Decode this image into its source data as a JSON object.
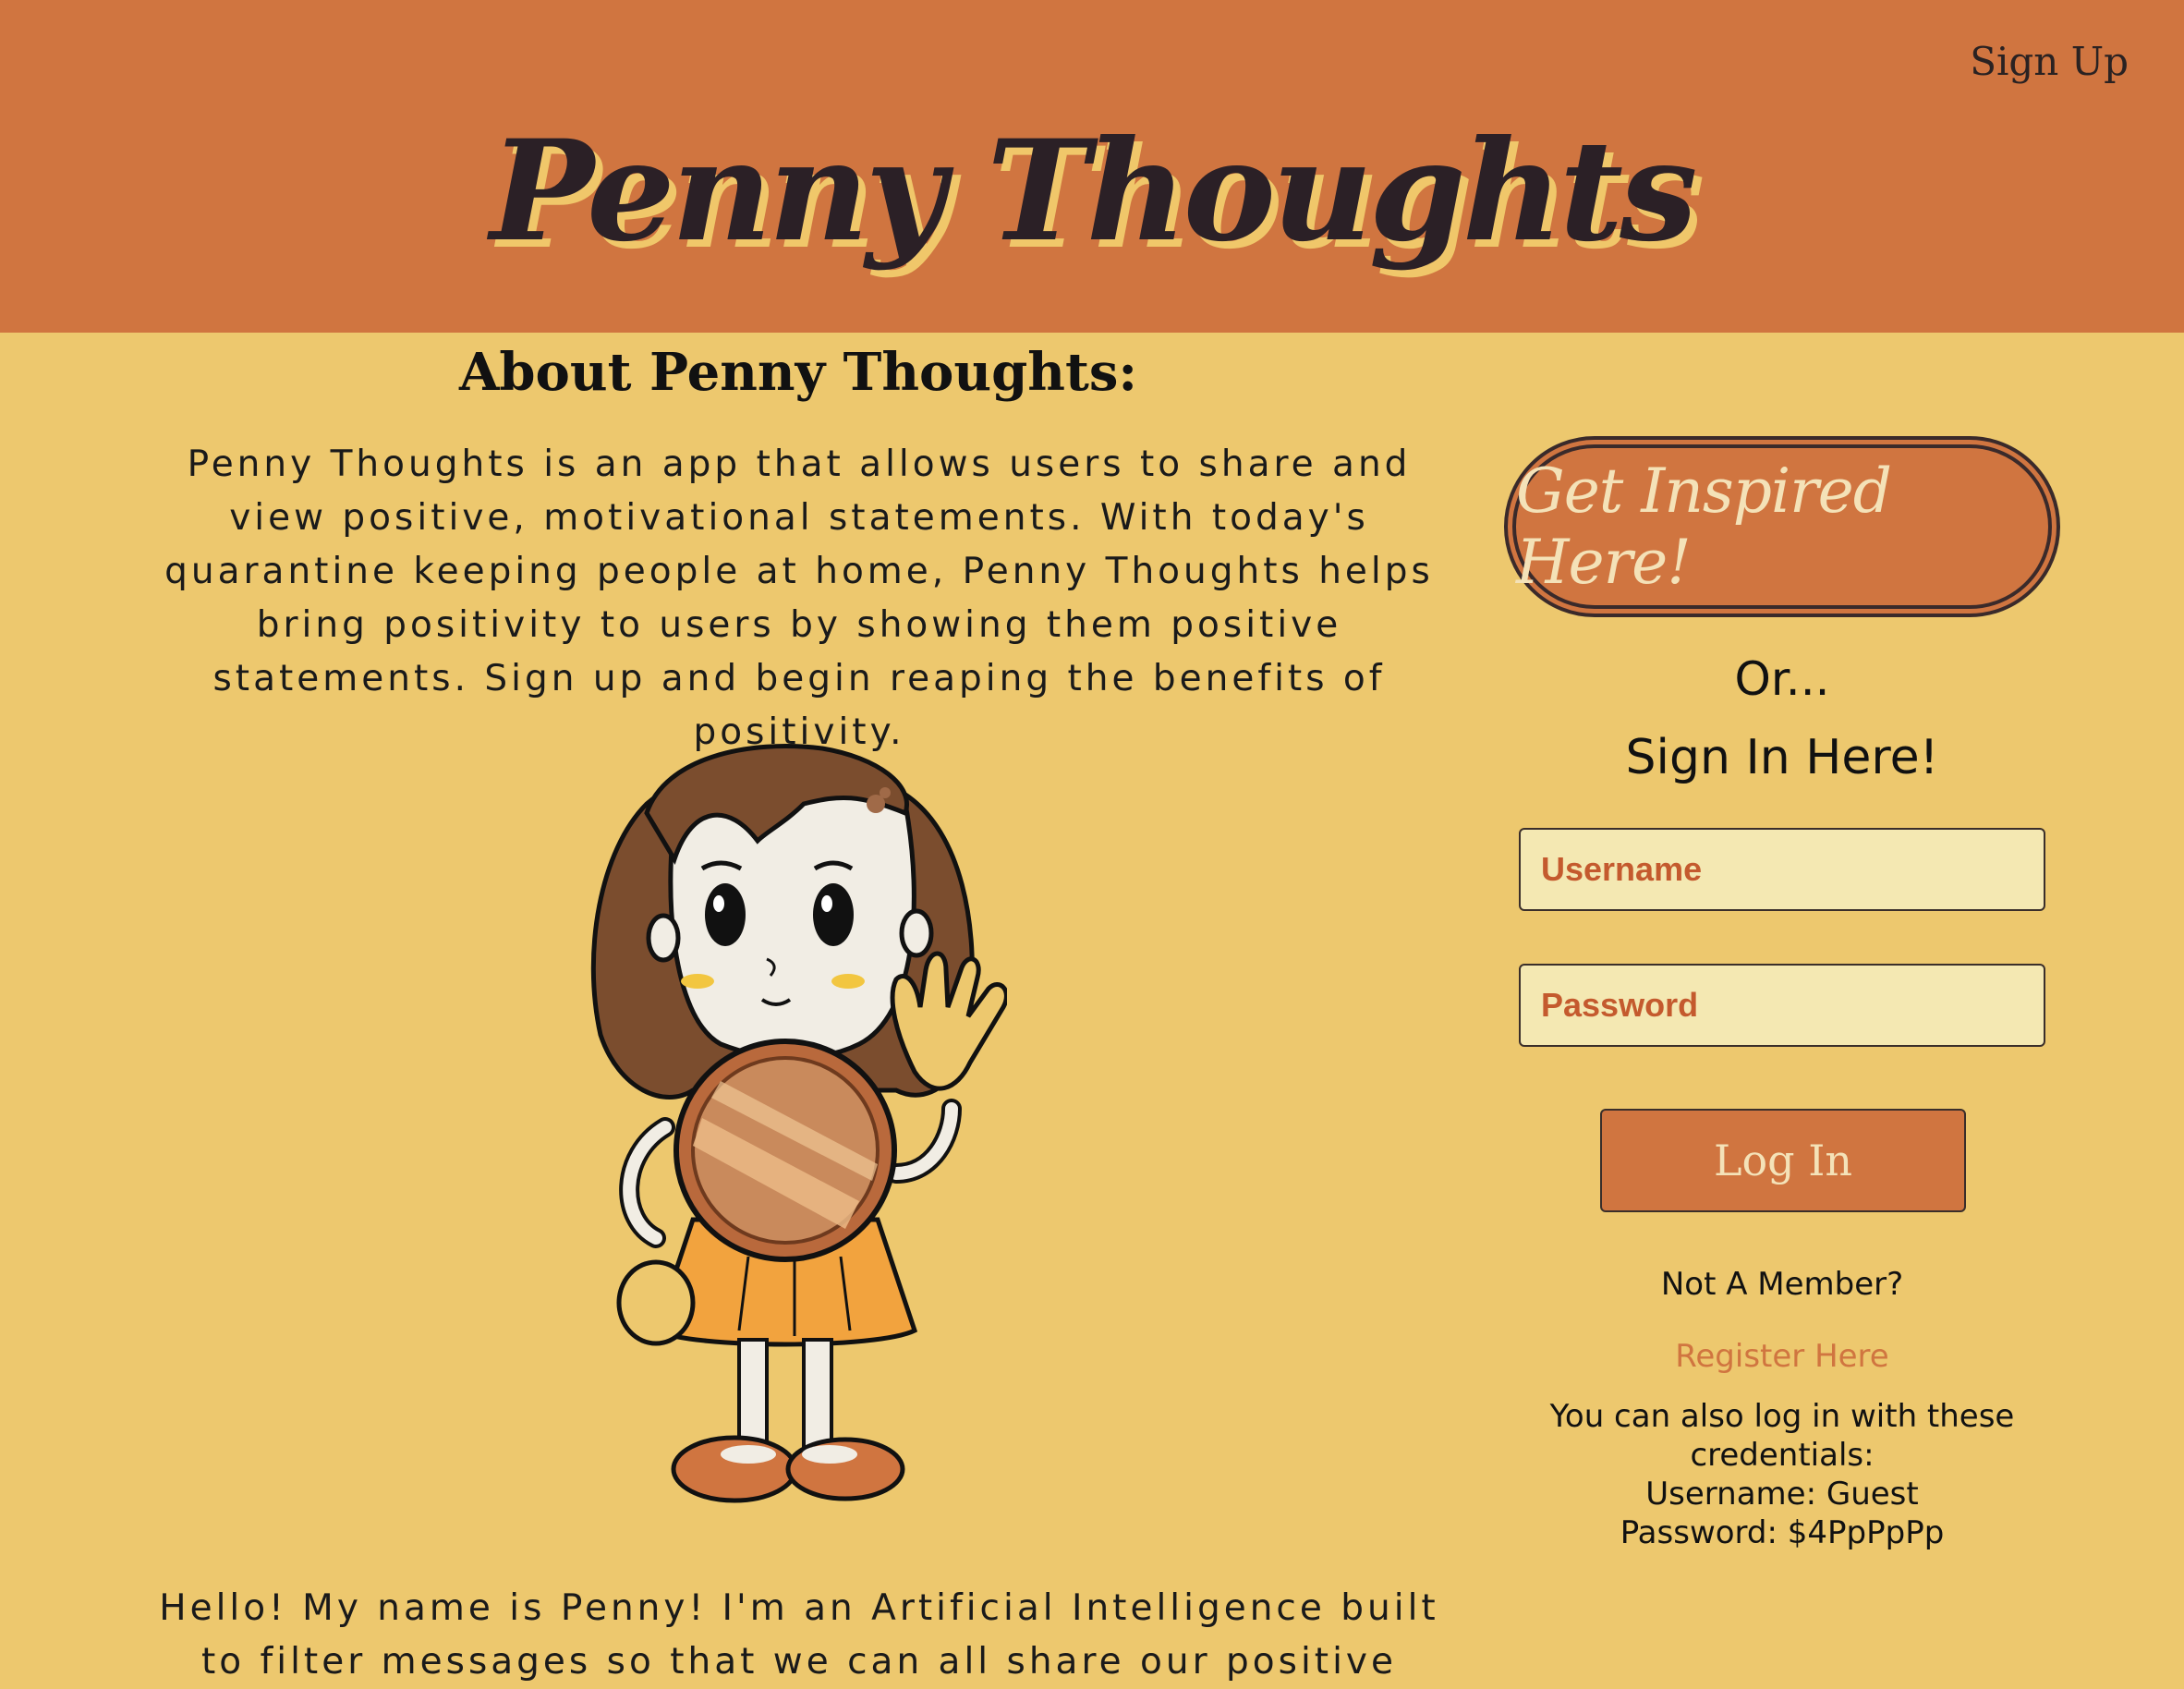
{
  "header": {
    "signup_label": "Sign Up",
    "brand_title": "Penny Thoughts"
  },
  "about": {
    "title": "About Penny Thoughts:",
    "text": "Penny Thoughts is an app that allows users to share and view positive, motivational statements. With today's quarantine keeping people at home, Penny Thoughts helps bring positivity to users by showing them positive statements. Sign up and begin reaping the benefits of positivity.",
    "hello_text": "Hello! My name is Penny! I'm an Artificial Intelligence built to filter messages so that we can all share our positive"
  },
  "mascot": {
    "icon": "penny-mascot-illustration"
  },
  "sidebar": {
    "inspire_label": "Get Inspired Here!",
    "or_text": "Or...",
    "signin_title": "Sign In Here!",
    "username_placeholder": "Username",
    "password_placeholder": "Password",
    "login_label": "Log In",
    "not_member": "Not A Member?",
    "register_label": "Register Here",
    "creds_line1": "You can also log in with these credentials:",
    "creds_user": "Username: Guest",
    "creds_pass": "Password: $4PpPpPp"
  },
  "colors": {
    "header_bg": "#D07540",
    "page_bg": "#EDC86E",
    "input_bg": "#F4E8B2",
    "accent_text": "#C45A2E",
    "button_text": "#F4E2B8"
  }
}
